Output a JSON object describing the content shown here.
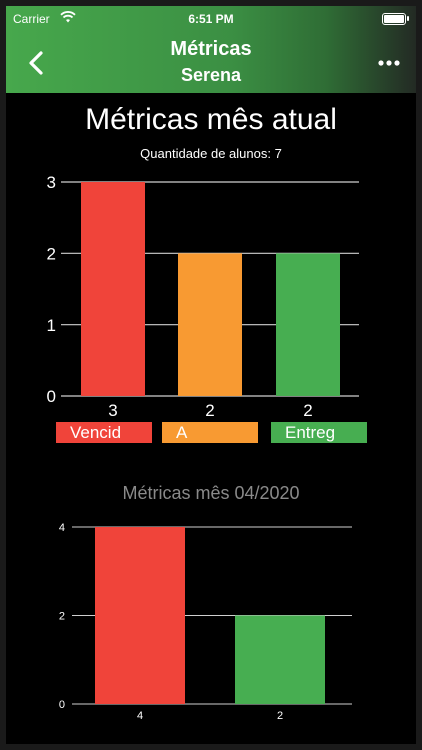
{
  "status": {
    "carrier": "Carrier",
    "time": "6:51 PM"
  },
  "nav": {
    "title": "Métricas",
    "subtitle": "Serena"
  },
  "current_month": {
    "title": "Métricas mês atual",
    "students_label": "Quantidade de alunos: 7",
    "legend": [
      "Vencid",
      "A",
      "Entreg"
    ]
  },
  "previous_month": {
    "title": "Métricas mês 04/2020"
  },
  "colors": {
    "red": "#f0443a",
    "orange": "#f89a32",
    "green": "#47ae51"
  },
  "chart_data": [
    {
      "type": "bar",
      "categories": [
        "Vencid",
        "A",
        "Entreg"
      ],
      "values": [
        3,
        2,
        2
      ],
      "data_labels": [
        "3",
        "2",
        "2"
      ],
      "colors": [
        "#f0443a",
        "#f89a32",
        "#47ae51"
      ],
      "yticks": [
        0,
        1,
        2,
        3
      ],
      "ylim": [
        0,
        3
      ],
      "grid": true
    },
    {
      "type": "bar",
      "values": [
        4,
        2
      ],
      "data_labels": [
        "4",
        "2"
      ],
      "colors": [
        "#f0443a",
        "#47ae51"
      ],
      "yticks": [
        0,
        2,
        4
      ],
      "ylim": [
        0,
        4
      ],
      "grid": true
    }
  ]
}
